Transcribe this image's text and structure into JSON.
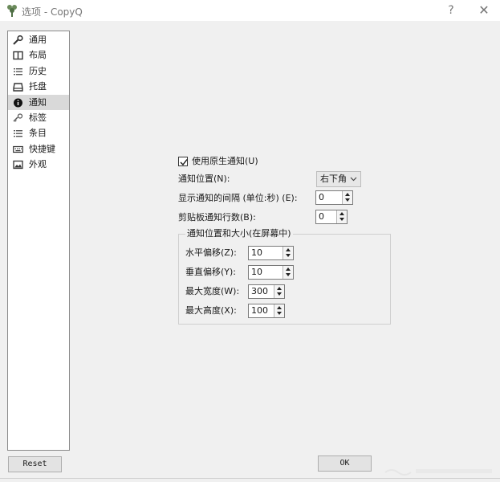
{
  "window": {
    "title": "选项 - CopyQ",
    "help": "?",
    "close": "✕"
  },
  "sidebar": {
    "items": [
      {
        "label": "通用",
        "icon": "wrench-icon"
      },
      {
        "label": "布局",
        "icon": "layout-icon"
      },
      {
        "label": "历史",
        "icon": "list-icon"
      },
      {
        "label": "托盘",
        "icon": "tray-icon"
      },
      {
        "label": "通知",
        "icon": "info-icon",
        "selected": true
      },
      {
        "label": "标签",
        "icon": "tabs-icon"
      },
      {
        "label": "条目",
        "icon": "items-icon"
      },
      {
        "label": "快捷键",
        "icon": "keyboard-icon"
      },
      {
        "label": "外观",
        "icon": "image-icon"
      }
    ]
  },
  "notifications": {
    "native_label": "使用原生通知(U)",
    "native_checked": true,
    "position_label": "通知位置(N):",
    "position_value": "右下角",
    "interval_label": "显示通知的间隔 (单位:秒) (E):",
    "interval_value": "0",
    "lines_label": "剪贴板通知行数(B):",
    "lines_value": "0",
    "geometry": {
      "title": "通知位置和大小(在屏幕中)",
      "hoffset_label": "水平偏移(Z):",
      "hoffset_value": "10",
      "voffset_label": "垂直偏移(Y):",
      "voffset_value": "10",
      "maxwidth_label": "最大宽度(W):",
      "maxwidth_value": "300",
      "maxheight_label": "最大高度(X):",
      "maxheight_value": "100"
    }
  },
  "buttons": {
    "reset": "Reset",
    "ok": "OK"
  }
}
